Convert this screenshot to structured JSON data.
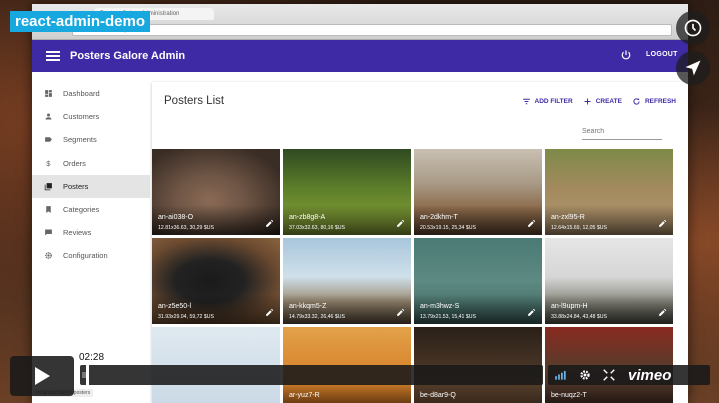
{
  "overlay": {
    "badge": "react-admin-demo",
    "right_buttons": [
      "clock-icon",
      "send-icon"
    ]
  },
  "browser": {
    "tab_title": "Posters Galore Administration",
    "url": "localhost:3000/#/posters"
  },
  "appbar": {
    "title": "Posters Galore Admin",
    "logout_label": "LOGOUT",
    "color": "#3f2aa6"
  },
  "sidebar": {
    "items": [
      {
        "label": "Dashboard",
        "icon": "dashboard-icon",
        "active": false
      },
      {
        "label": "Customers",
        "icon": "person-icon",
        "active": false
      },
      {
        "label": "Segments",
        "icon": "label-icon",
        "active": false
      },
      {
        "label": "Orders",
        "icon": "dollar-icon",
        "active": false
      },
      {
        "label": "Posters",
        "icon": "collections-icon",
        "active": true
      },
      {
        "label": "Categories",
        "icon": "bookmark-icon",
        "active": false
      },
      {
        "label": "Reviews",
        "icon": "comment-icon",
        "active": false
      },
      {
        "label": "Configuration",
        "icon": "settings-icon",
        "active": false
      }
    ]
  },
  "main": {
    "title": "Posters List",
    "actions": {
      "add_filter": "ADD FILTER",
      "create": "CREATE",
      "refresh": "REFRESH"
    },
    "search_placeholder": "Search",
    "posters": [
      {
        "reference": "an-ai038-O",
        "details": "12.81x36.63, 30,29 $US"
      },
      {
        "reference": "an-zb8g8-A",
        "details": "37.03x32.63, 80,16 $US"
      },
      {
        "reference": "an-2dkhm-T",
        "details": "20.53x19.15, 25,34 $US"
      },
      {
        "reference": "an-zxl95-R",
        "details": "12.64x15.69, 12,05 $US"
      },
      {
        "reference": "an-z5e50-l",
        "details": "31.93x29.04, 59,72 $US"
      },
      {
        "reference": "an-kkqm5-Z",
        "details": "14.79x33.32, 26,46 $US"
      },
      {
        "reference": "an-m3hwz-S",
        "details": "13.79x21.53, 15,41 $US"
      },
      {
        "reference": "an-l9upm-H",
        "details": "33.88x24.84, 43,48 $US"
      },
      {
        "reference": "",
        "details": ""
      },
      {
        "reference": "ar-yuz7-R",
        "details": ""
      },
      {
        "reference": "be-d8ar9-Q",
        "details": ""
      },
      {
        "reference": "be-nuqz2-T",
        "details": ""
      }
    ]
  },
  "player": {
    "time": "02:28",
    "progress": 0.013,
    "brand": "vimeo"
  }
}
